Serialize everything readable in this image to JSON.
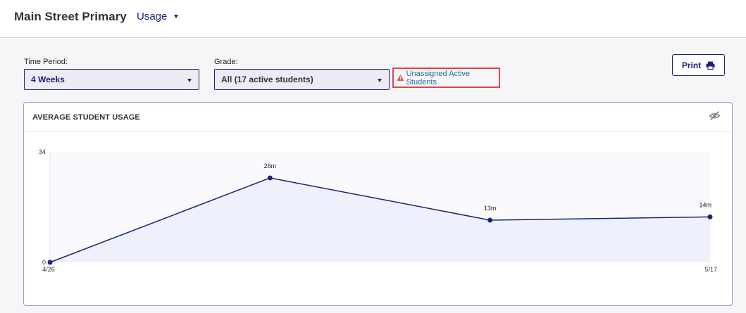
{
  "header": {
    "school_name": "Main Street Primary",
    "section_label": "Usage"
  },
  "filters": {
    "time_period": {
      "label": "Time Period:",
      "value": "4 Weeks"
    },
    "grade": {
      "label": "Grade:",
      "value": "All (17 active students)"
    },
    "warning_link": "Unassigned Active Students",
    "print_label": "Print"
  },
  "colors": {
    "brand": "#1d2378",
    "warning": "#e04545",
    "link": "#1a6fa8",
    "area_fill": "#eef0fb"
  },
  "icons": {
    "warning": "warning-triangle-icon",
    "print": "printer-icon",
    "hide": "eye-slash-icon",
    "caret": "caret-down-icon"
  },
  "card": {
    "title": "AVERAGE STUDENT USAGE"
  },
  "chart_data": {
    "type": "area",
    "title": "AVERAGE STUDENT USAGE",
    "x": [
      0,
      1,
      2,
      3
    ],
    "points": [
      {
        "x": 0,
        "y": 0,
        "label": ""
      },
      {
        "x": 1,
        "y": 26,
        "label": "26m"
      },
      {
        "x": 2,
        "y": 13,
        "label": "13m"
      },
      {
        "x": 3,
        "y": 14,
        "label": "14m"
      }
    ],
    "x_tick_labels": [
      {
        "x": 0,
        "text": "4/26"
      },
      {
        "x": 3,
        "text": "5/17"
      }
    ],
    "y_tick_labels": [
      "34",
      "0"
    ],
    "ylim": [
      0,
      34
    ],
    "grid": false,
    "legend": "none"
  }
}
